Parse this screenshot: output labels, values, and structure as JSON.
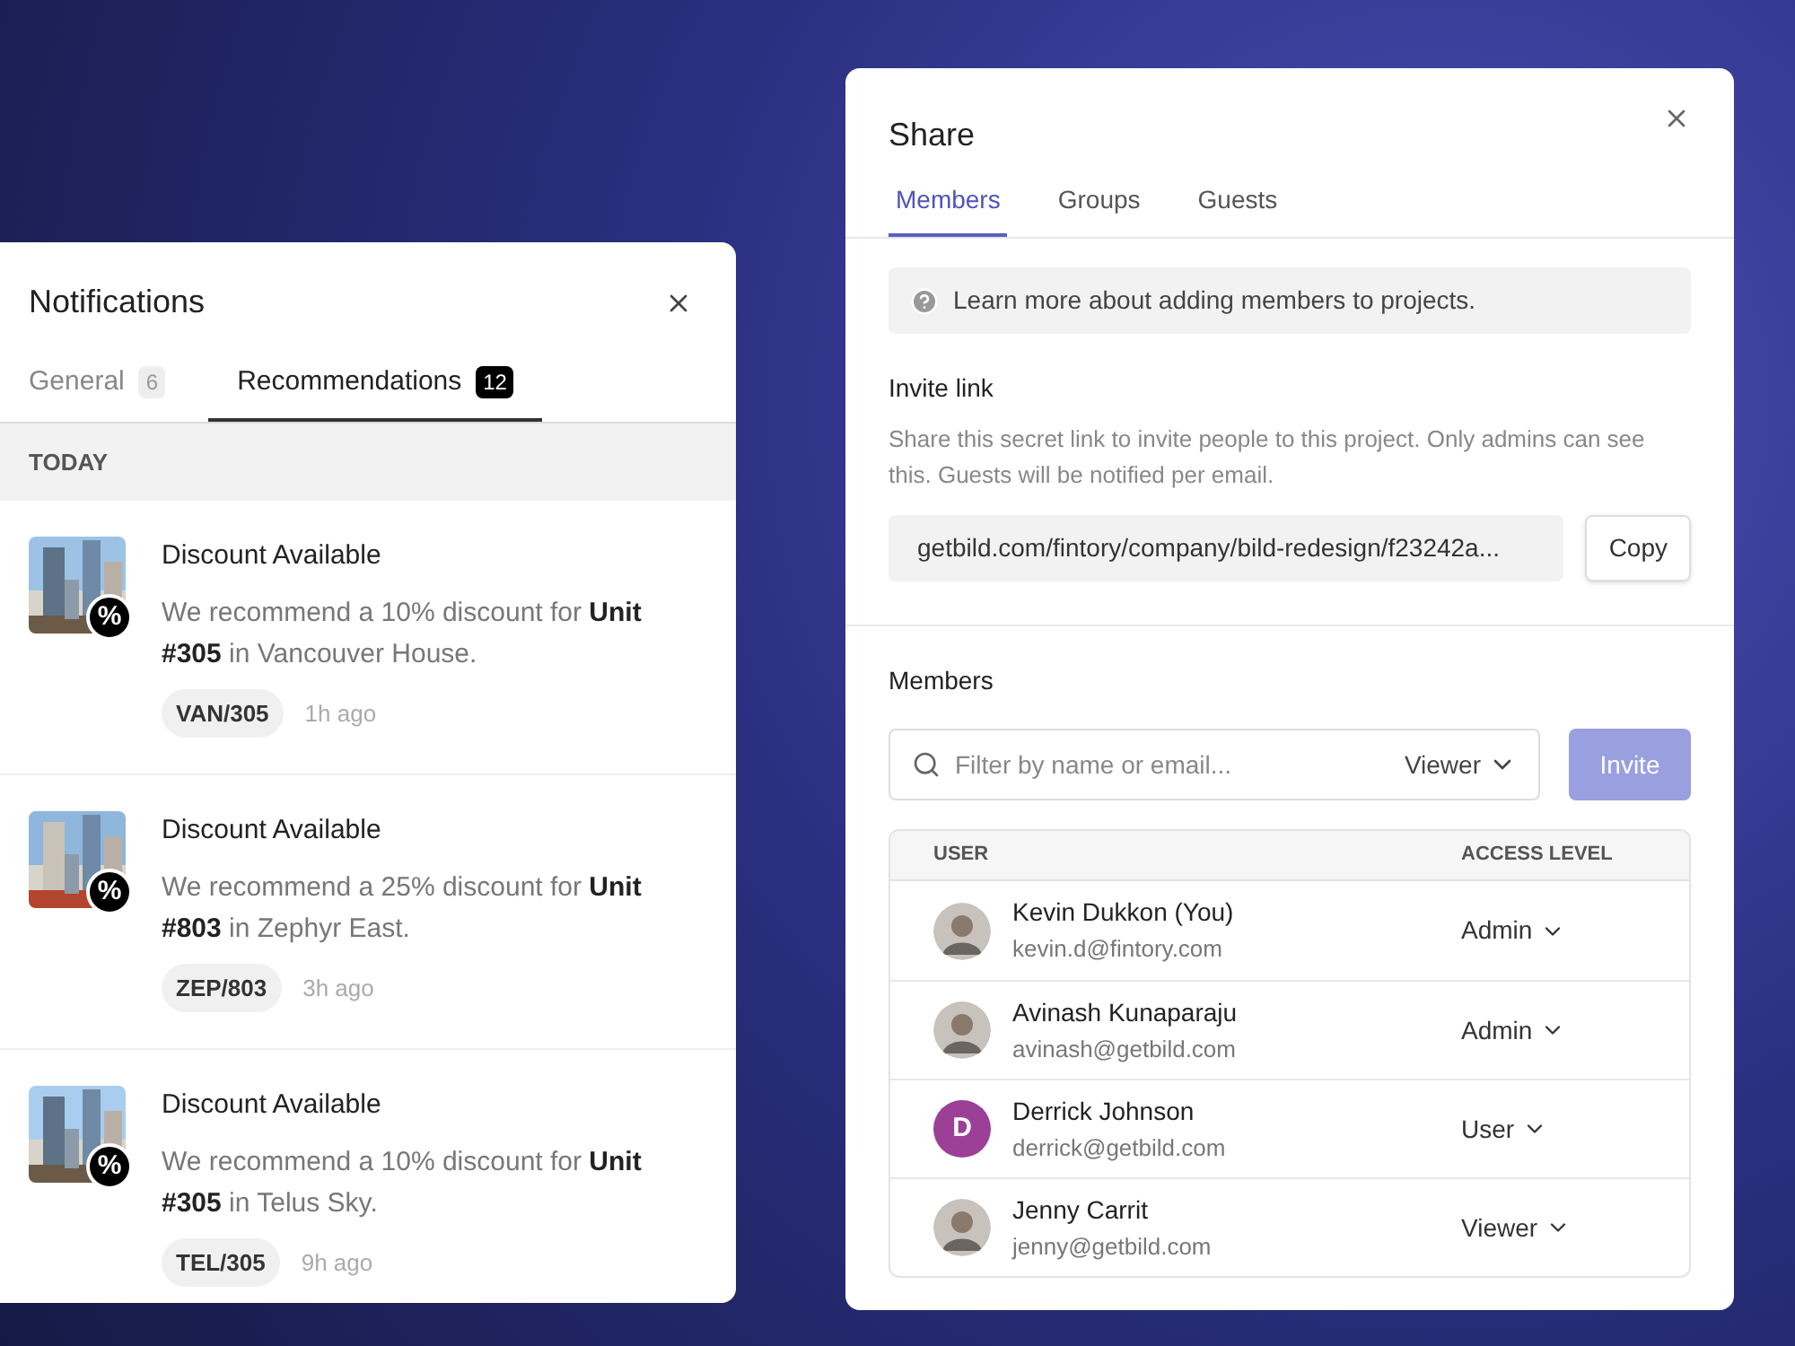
{
  "notifications": {
    "title": "Notifications",
    "tabs": [
      {
        "label": "General",
        "count": "6",
        "selected": false
      },
      {
        "label": "Recommendations",
        "count": "12",
        "selected": true
      }
    ],
    "section": "TODAY",
    "items": [
      {
        "kind": "picture",
        "badge": "%",
        "title": "Discount Available",
        "body": "We recommend a 10% discount for **Unit #305** in Vancouver House.",
        "tag": "VAN/305",
        "time": "1h ago"
      },
      {
        "kind": "picture",
        "badge": "%",
        "title": "Discount Available",
        "body": "We recommend a 25% discount for **Unit #803** in Zephyr East.",
        "tag": "ZEP/803",
        "time": "3h ago"
      },
      {
        "kind": "picture",
        "badge": "%",
        "title": "Discount Available",
        "body": "We recommend a 10% discount for **Unit #305** in Telus Sky.",
        "tag": "TEL/305",
        "time": "9h ago"
      }
    ]
  },
  "share": {
    "title": "Share",
    "tabs": [
      {
        "label": "Members",
        "selected": true
      },
      {
        "label": "Groups",
        "selected": false
      },
      {
        "label": "Guests",
        "selected": false
      }
    ],
    "info": "Learn more about adding members to projects.",
    "invite_link": {
      "heading": "Invite link",
      "description": "Share this secret link to invite people to this project. Only admins can see this. Guests will be notified per email.",
      "value": "getbild.com/fintory/company/bild-redesign/f23242a...",
      "button": "Copy"
    },
    "members": {
      "heading": "Members",
      "search": {
        "placeholder": "Filter by name or email..."
      },
      "role": "Viewer",
      "invite": {
        "label": "Invite",
        "disabled": true
      },
      "columns": [
        "USER",
        "ACCESS LEVEL"
      ],
      "rows": [
        {
          "name": "Kevin Dukkon (You)",
          "email": "kevin.d@fintory.com",
          "access": "Admin"
        },
        {
          "name": "Avinash Kunaparaju",
          "email": "avinash@getbild.com",
          "access": "Admin"
        },
        {
          "avatar": {
            "kind": "initial",
            "initial": "D",
            "color": "#9b3f97"
          },
          "name": "Derrick Johnson",
          "email": "derrick@getbild.com",
          "access": "User"
        },
        {
          "name": "Jenny Carrit",
          "email": "jenny@getbild.com",
          "access": "Viewer"
        }
      ]
    }
  }
}
